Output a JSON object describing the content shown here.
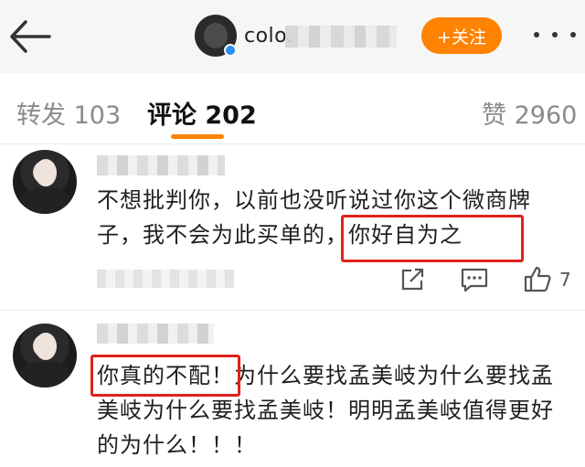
{
  "header": {
    "username_visible": "colo.",
    "follow_label": "+关注"
  },
  "tabs": [
    {
      "label": "转发 103"
    },
    {
      "label": "评论 202"
    },
    {
      "label": "赞 2960"
    }
  ],
  "comments": [
    {
      "text": "不想批判你，以前也没听说过你这个微商牌子，我不会为此买单的，你好自为之",
      "highlighted": "，你好自为之",
      "likes": "7"
    },
    {
      "text": "你真的不配！为什么要找孟美岐为什么要找孟美岐为什么要找孟美岐！明明孟美岐值得更好的为什么！！！",
      "highlighted": "你真的不配！"
    }
  ],
  "colors": {
    "accent": "#ff8200",
    "highlight_box": "#e0211b",
    "verify_badge": "#2e8ef0"
  },
  "icons": [
    "back-arrow-icon",
    "more-icon",
    "share-icon",
    "comment-icon",
    "thumbs-up-icon",
    "verified-badge-icon"
  ]
}
